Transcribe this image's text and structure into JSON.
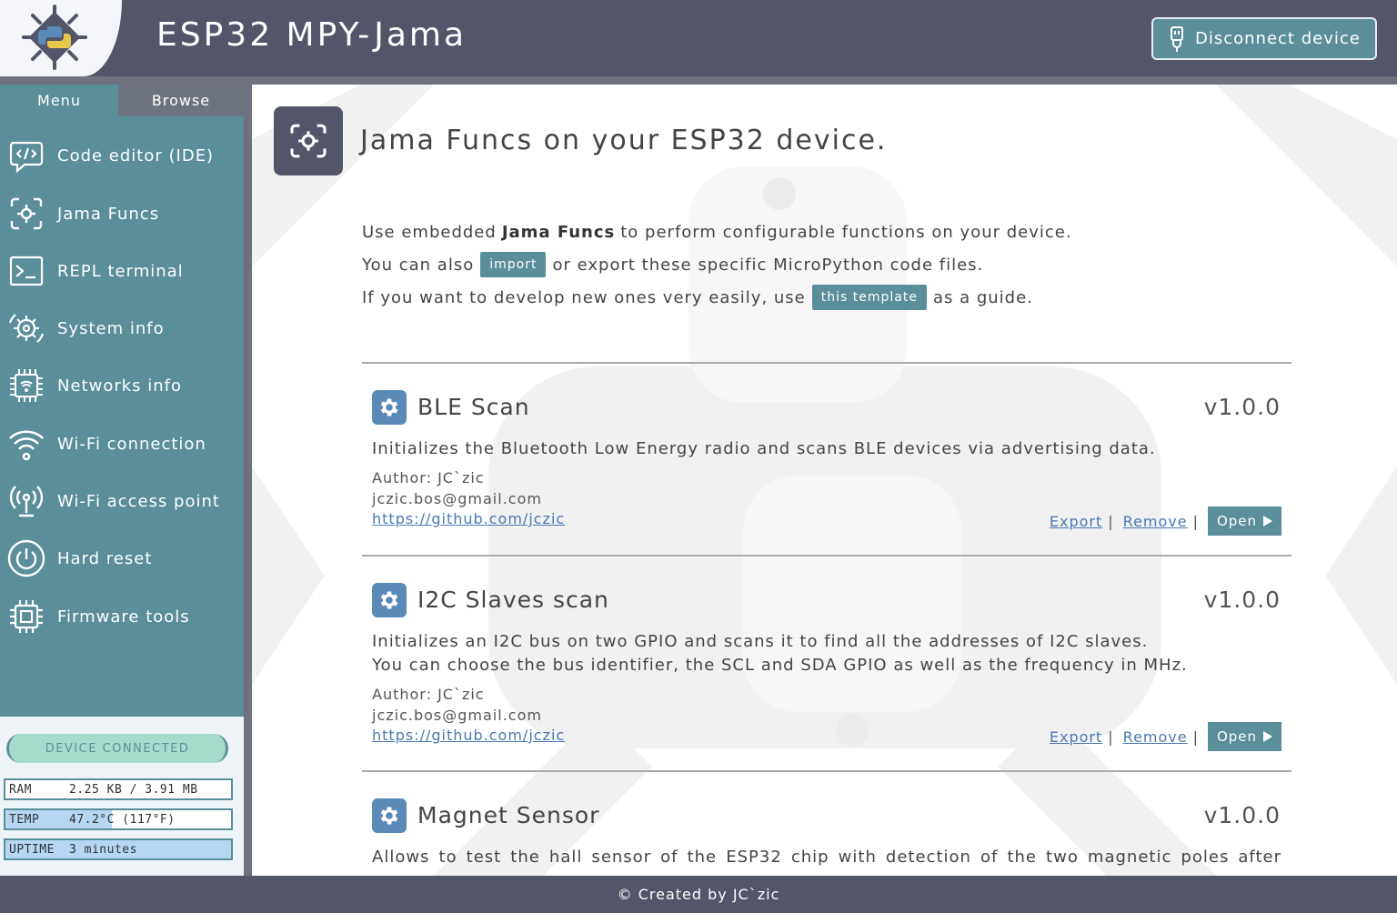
{
  "header": {
    "title": "ESP32 MPY-Jama",
    "disconnect_label": "Disconnect device"
  },
  "sidebar": {
    "tabs": [
      "Menu",
      "Browse"
    ],
    "items": [
      {
        "label": "Code editor (IDE)",
        "icon": "code-editor-icon"
      },
      {
        "label": "Jama Funcs",
        "icon": "jama-funcs-icon"
      },
      {
        "label": "REPL terminal",
        "icon": "terminal-icon"
      },
      {
        "label": "System info",
        "icon": "system-info-icon"
      },
      {
        "label": "Networks info",
        "icon": "networks-info-icon"
      },
      {
        "label": "Wi-Fi connection",
        "icon": "wifi-icon"
      },
      {
        "label": "Wi-Fi access point",
        "icon": "access-point-icon"
      },
      {
        "label": "Hard reset",
        "icon": "power-icon"
      },
      {
        "label": "Firmware tools",
        "icon": "chip-icon"
      }
    ]
  },
  "status": {
    "connection": "DEVICE CONNECTED",
    "ram": {
      "key": "RAM",
      "value": "2.25 KB / 3.91 MB",
      "fill": 0.0
    },
    "temp": {
      "key": "TEMP",
      "value": "47.2°C (117°F)",
      "fill": 0.47
    },
    "uptime": {
      "key": "UPTIME",
      "value": "3 minutes",
      "fill": 1.0
    }
  },
  "page": {
    "title": "Jama Funcs on your ESP32 device.",
    "intro1_pre": "Use embedded",
    "intro1_bold": "Jama Funcs",
    "intro1_post": "to perform configurable functions on your device.",
    "intro2_pre": "You can also",
    "import_label": "import",
    "intro2_post": "or export these specific MicroPython code files.",
    "intro3_pre": "If you want to develop new ones very easily, use",
    "template_label": "this template",
    "intro3_post": "as a guide."
  },
  "funcs": [
    {
      "name": "BLE Scan",
      "version": "v1.0.0",
      "description": "Initializes the Bluetooth Low Energy radio and scans BLE devices via advertising data.",
      "author": "Author: JC`zic",
      "email": "jczic.bos@gmail.com",
      "url": "https://github.com/jczic"
    },
    {
      "name": "I2C Slaves scan",
      "version": "v1.0.0",
      "description": "Initializes an I2C bus on two GPIO and scans it to find all the addresses of I2C slaves.",
      "description2": "You can choose the bus identifier, the SCL and SDA GPIO as well as the frequency in MHz.",
      "author": "Author: JC`zic",
      "email": "jczic.bos@gmail.com",
      "url": "https://github.com/jczic"
    },
    {
      "name": "Magnet Sensor",
      "version": "v1.0.0",
      "description": "Allows to test the hall sensor of the ESP32 chip with detection of the two magnetic poles after"
    }
  ],
  "actions": {
    "export": "Export",
    "remove": "Remove",
    "open": "Open",
    "sep": "|"
  },
  "footer": "© Created by JC`zic",
  "colors": {
    "header": "#535568",
    "accent": "#5a8e99",
    "func_icon": "#5a8ab8",
    "pill": "#a7dccc"
  }
}
